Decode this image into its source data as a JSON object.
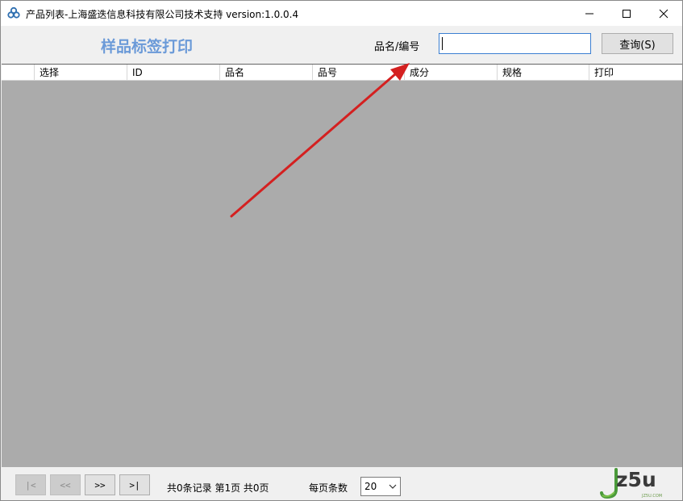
{
  "window": {
    "title": "产品列表-上海盛迭信息科技有限公司技术支持 version:1.0.0.4",
    "icon": "biohazard-cluster-icon"
  },
  "header": {
    "page_title": "样品标签打印",
    "search_label": "品名/编号",
    "search_value": "",
    "query_button": "查询(S)"
  },
  "grid": {
    "columns": [
      "选择",
      "ID",
      "品名",
      "品号",
      "成分",
      "规格",
      "打印"
    ],
    "rows": []
  },
  "pager": {
    "first": "|<",
    "prev": "<<",
    "next": ">>",
    "last": ">|",
    "record_info": "共0条记录 第1页 共0页",
    "page_size_label": "每页条数",
    "page_size": "20"
  },
  "watermark": {
    "text": "z5u",
    "sub": "JZ5U.COM"
  },
  "colors": {
    "title_blue": "#6b9ad8",
    "grid_bg": "#ababab",
    "arrow_red": "#d42020",
    "watermark_green": "#4a9a3a"
  }
}
